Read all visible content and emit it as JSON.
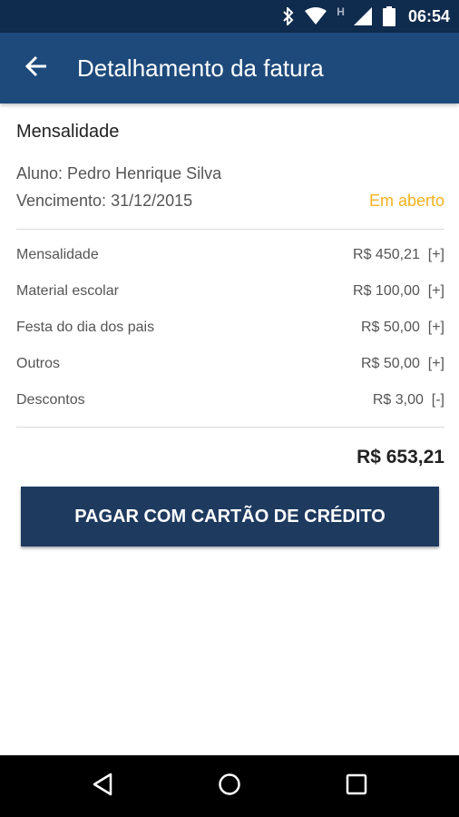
{
  "status_bar": {
    "time": "06:54",
    "network_indicator": "H",
    "icons": [
      "bluetooth-icon",
      "wifi-icon",
      "signal-icon",
      "battery-icon"
    ]
  },
  "app_bar": {
    "title": "Detalhamento da fatura",
    "back_icon": "arrow-left-icon"
  },
  "invoice": {
    "section_title": "Mensalidade",
    "student": "Aluno: Pedro Henrique Silva",
    "due_date": "Vencimento: 31/12/2015",
    "status": "Em aberto",
    "items": [
      {
        "label": "Mensalidade",
        "value": "R$ 450,21",
        "sign": "[+]"
      },
      {
        "label": "Material escolar",
        "value": "R$ 100,00",
        "sign": "[+]"
      },
      {
        "label": "Festa do dia dos pais",
        "value": "R$ 50,00",
        "sign": "[+]"
      },
      {
        "label": "Outros",
        "value": "R$ 50,00",
        "sign": "[+]"
      },
      {
        "label": "Descontos",
        "value": "R$ 3,00",
        "sign": "[-]"
      }
    ],
    "total": "R$ 653,21"
  },
  "actions": {
    "pay_label": "PAGAR COM CARTÃO DE CRÉDITO"
  },
  "nav": {
    "back": "nav-back-icon",
    "home": "nav-home-icon",
    "recents": "nav-recents-icon"
  },
  "colors": {
    "status_bar": "#0f2b4d",
    "app_bar": "#1e4a7b",
    "button": "#1e3a5f",
    "status_open": "#f4b11e"
  }
}
